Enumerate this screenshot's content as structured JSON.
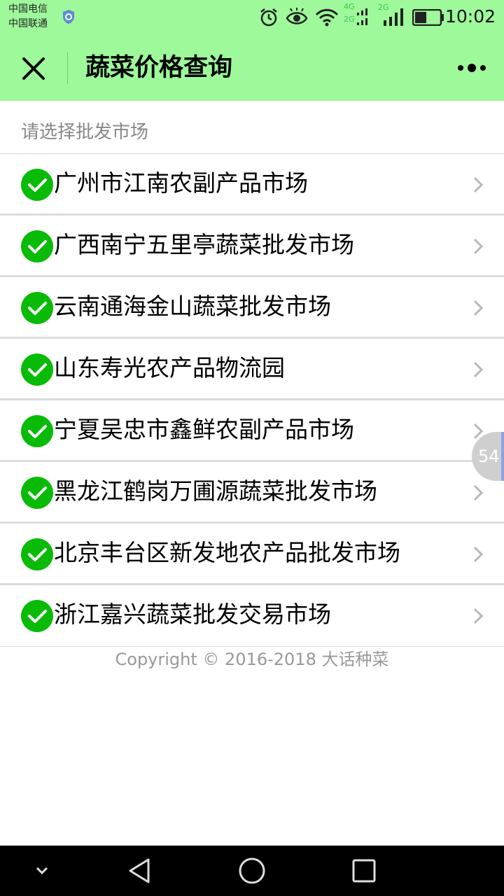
{
  "status_bar": {
    "carrier_1": "中国电信",
    "carrier_2": "中国联通",
    "net_1": "4G",
    "net_1b": "2G",
    "net_2": "2G",
    "time": "10:02"
  },
  "header": {
    "title": "蔬菜价格查询",
    "close_icon": "close-icon",
    "more_icon": "more-dots-icon",
    "bg_color": "#9df99a"
  },
  "section": {
    "heading": "请选择批发市场"
  },
  "markets": [
    {
      "label": "广州市江南农副产品市场"
    },
    {
      "label": "广西南宁五里亭蔬菜批发市场"
    },
    {
      "label": "云南通海金山蔬菜批发市场"
    },
    {
      "label": "山东寿光农产品物流园"
    },
    {
      "label": "宁夏吴忠市鑫鲜农副产品市场"
    },
    {
      "label": "黑龙江鹤岗万圃源蔬菜批发市场"
    },
    {
      "label": "北京丰台区新发地农产品批发市场"
    },
    {
      "label": "浙江嘉兴蔬菜批发交易市场"
    }
  ],
  "check_color": "#09bb07",
  "footer": {
    "copyright": "Copyright © 2016-2018 大话种菜"
  },
  "floating_badge": {
    "value": "54"
  }
}
